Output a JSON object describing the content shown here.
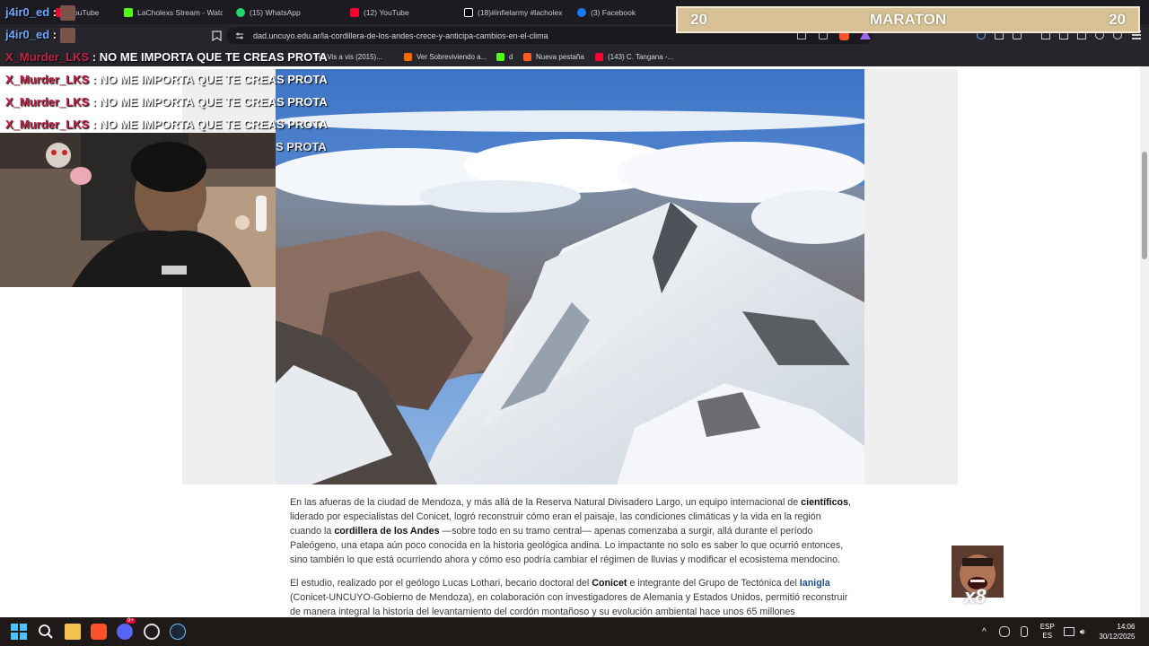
{
  "browser": {
    "tabs": [
      {
        "label": "YouTube",
        "icon": "youtube-icon",
        "color": "#ff0033"
      },
      {
        "label": "LaCholexs Stream - Watch",
        "icon": "kick-icon",
        "color": "#53fc18"
      },
      {
        "label": "(15) WhatsApp",
        "icon": "whatsapp-icon",
        "color": "#25d366"
      },
      {
        "label": "(12) YouTube",
        "icon": "youtube-icon",
        "color": "#ff0033"
      },
      {
        "label": "(18)#infielarmy #lacholex",
        "icon": "tiktok-icon",
        "color": "#ffffff"
      },
      {
        "label": "(3) Facebook",
        "icon": "facebook-icon",
        "color": "#1877f2"
      }
    ],
    "url": "dad.uncuyo.edu.ar/la-cordillera-de-los-andes-crece-y-anticipa-cambios-en-el-clima",
    "bookmarks": [
      {
        "label": "Ver Vis a vis (2015)...",
        "color": "#888888"
      },
      {
        "label": "Ver Sobreviviendo a...",
        "color": "#ff6a00"
      },
      {
        "label": "d",
        "color": "#53fc18"
      },
      {
        "label": "Nueva pestaña",
        "color": "#ff5a1f"
      },
      {
        "label": "(143) C. Tangana -...",
        "color": "#ff0033"
      }
    ]
  },
  "overlay": {
    "maraton": {
      "left": "20",
      "title": "MARATON",
      "right": "20"
    },
    "chat": [
      {
        "user": "j4ir0_ed",
        "sep": ":",
        "msg": "",
        "style": "blue"
      },
      {
        "user": "j4ir0_ed",
        "sep": ":",
        "msg": "",
        "style": "blue"
      },
      {
        "user": "X_Murder_LKS",
        "sep": ":",
        "msg": "NO ME IMPORTA QUE TE CREAS PROTA",
        "style": "red"
      },
      {
        "user": "X_Murder_LKS",
        "sep": ":",
        "msg": "NO ME IMPORTA QUE TE CREAS PROTA",
        "style": "red"
      },
      {
        "user": "X_Murder_LKS",
        "sep": ":",
        "msg": "NO ME IMPORTA QUE TE CREAS PROTA",
        "style": "red"
      },
      {
        "user": "X_Murder_LKS",
        "sep": ":",
        "msg": "NO ME IMPORTA QUE TE CREAS PROTA",
        "style": "red"
      },
      {
        "user": "",
        "sep": "",
        "msg": "S PROTA",
        "style": "red"
      }
    ],
    "sticker_count": "x8"
  },
  "article": {
    "p1": {
      "t1": "En las afueras de la ciudad de Mendoza, y más allá de la Reserva Natural Divisadero Largo, un equipo internacional de ",
      "b1": "científicos",
      "t2": ", liderado por especialistas del Conicet, logró reconstruir cómo eran el paisaje, las condiciones climáticas y la vida en la región cuando la ",
      "b2": "cordillera de los Andes",
      "t3": " —sobre todo en su tramo central— apenas comenzaba a surgir, allá durante el período Paleógeno, una etapa aún poco conocida en la historia geológica andina. Lo impactante no solo es saber lo que ocurrió entonces, sino también lo que está ocurriendo ahora y cómo eso podría cambiar el régimen de lluvias y modificar el ecosistema mendocino."
    },
    "p2": {
      "t1": "El estudio, realizado por el geólogo Lucas Lothari, becario doctoral del ",
      "b1": "Conicet",
      "t2": " e integrante del Grupo de Tectónica del ",
      "link": "Ianigla",
      "t3": " (Conicet-UNCUYO-Gobierno de Mendoza), en colaboración con investigadores de Alemania y Estados Unidos, permitió reconstruir de manera integral la historia del levantamiento del cordón montañoso y su evolución ambiental hace unos 65 millones"
    }
  },
  "taskbar": {
    "lang_top": "ESP",
    "lang_bottom": "ES",
    "time": "14:06",
    "date": "30/12/2025",
    "discord_badge": "9+"
  },
  "colors": {
    "tabbar_bg": "#1c1b22",
    "page_bg": "#ffffff",
    "maraton_bg": "#d8c196",
    "chat_user": "#c32347",
    "taskbar_bg": "#1f1a17"
  }
}
